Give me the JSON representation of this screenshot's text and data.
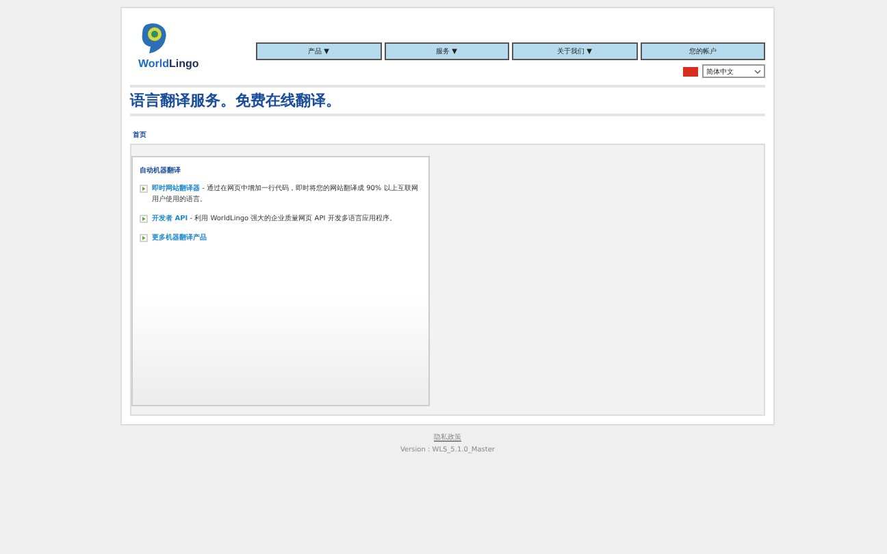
{
  "brand": {
    "name_part1": "World",
    "name_part2": "Lingo"
  },
  "nav": [
    {
      "label": "产品",
      "caret": "▼"
    },
    {
      "label": "服务",
      "caret": "▼"
    },
    {
      "label": "关于我们",
      "caret": "▼"
    },
    {
      "label": "您的帐户"
    }
  ],
  "language": {
    "value": "简体中文"
  },
  "headline": "语言翻译服务。免费在线翻译。",
  "breadcrumb": "首页",
  "panel": {
    "title": "自动机器翻译",
    "items": [
      {
        "link": "即时网站翻译器",
        "text": " - 通过在网页中增加一行代码，即时将您的网站翻译成 90% 以上互联网用户使用的语言。"
      },
      {
        "link": "开发者 API",
        "text": " - 利用 WorldLingo 强大的企业质量网页 API 开发多语言应用程序。"
      },
      {
        "link": "更多机器翻译产品"
      }
    ]
  },
  "footer": {
    "links": [
      "隐私政策"
    ],
    "version": "Version : WLS_5.1.0_Master"
  }
}
